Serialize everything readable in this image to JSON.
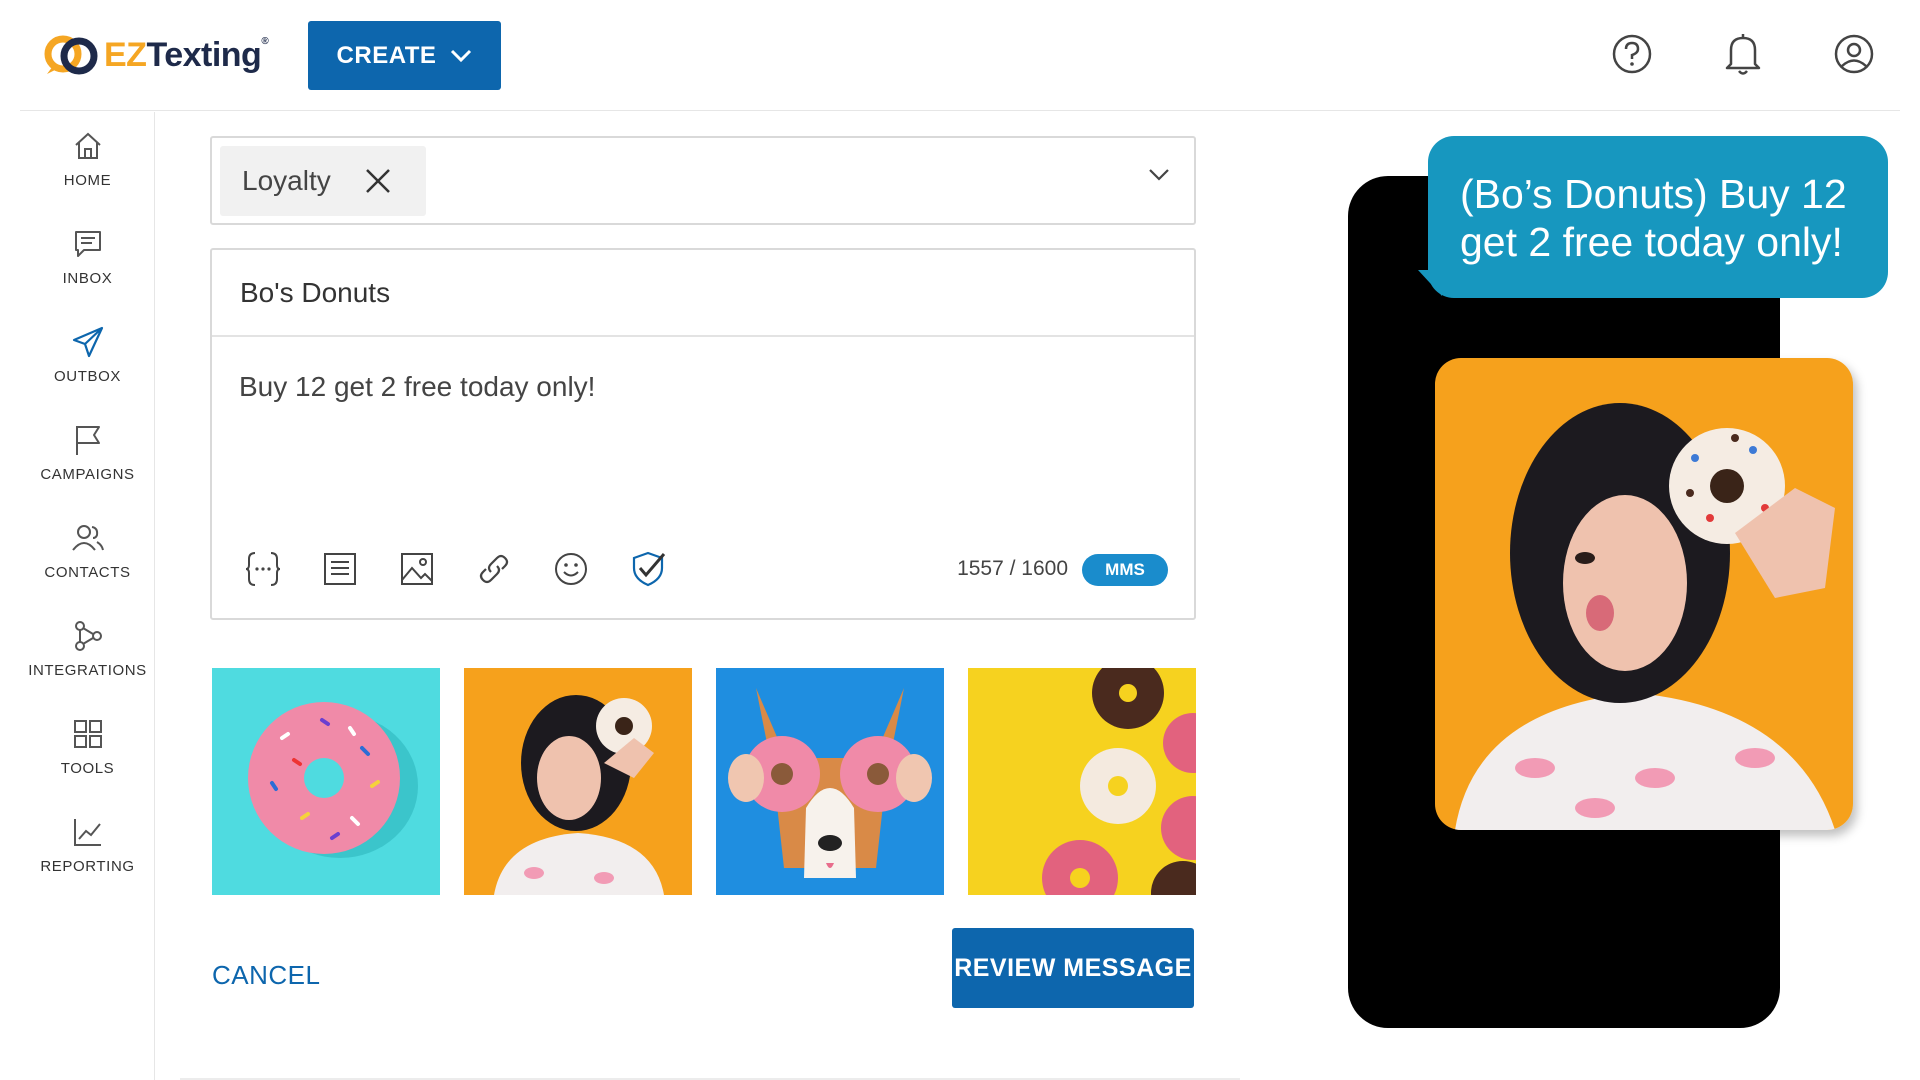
{
  "header": {
    "logo": {
      "ez": "EZ",
      "texting": "Texting",
      "reg": "®"
    },
    "create_label": "CREATE",
    "icons": [
      "help-icon",
      "bell-icon",
      "user-icon"
    ]
  },
  "sidebar": {
    "items": [
      {
        "label": "HOME",
        "icon": "home-icon",
        "active": false
      },
      {
        "label": "INBOX",
        "icon": "inbox-icon",
        "active": false
      },
      {
        "label": "OUTBOX",
        "icon": "send-icon",
        "active": true
      },
      {
        "label": "CAMPAIGNS",
        "icon": "flag-icon",
        "active": false
      },
      {
        "label": "CONTACTS",
        "icon": "contacts-icon",
        "active": false
      },
      {
        "label": "INTEGRATIONS",
        "icon": "integrations-icon",
        "active": false
      },
      {
        "label": "TOOLS",
        "icon": "tools-grid-icon",
        "active": false
      },
      {
        "label": "REPORTING",
        "icon": "chart-icon",
        "active": false
      }
    ]
  },
  "compose": {
    "tag": "Loyalty",
    "from_name": "Bo's Donuts",
    "body": "Buy 12 get 2 free today only!",
    "char_count": "1557 / 1600",
    "message_type": "MMS",
    "toolbar_icons": [
      "merge-field-icon",
      "template-icon",
      "image-icon",
      "link-icon",
      "emoji-icon",
      "compliance-check-icon"
    ]
  },
  "gallery": {
    "items": [
      {
        "name": "pink-donut-image",
        "selected": false
      },
      {
        "name": "woman-donut-image",
        "selected": true
      },
      {
        "name": "dog-donut-glasses-image",
        "selected": false
      },
      {
        "name": "donuts-yellow-image",
        "selected": false
      }
    ]
  },
  "actions": {
    "cancel_label": "CANCEL",
    "review_label": "REVIEW MESSAGE"
  },
  "preview": {
    "bubble_line1": "(Bo’s Donuts) Buy 12",
    "bubble_line2": "get 2 free today only!"
  },
  "colors": {
    "primary": "#0d66ad",
    "bubble": "#1797bf",
    "mms_badge": "#1a8ccc",
    "logo_orange": "#f5a623",
    "logo_navy": "#1e2a4a"
  }
}
